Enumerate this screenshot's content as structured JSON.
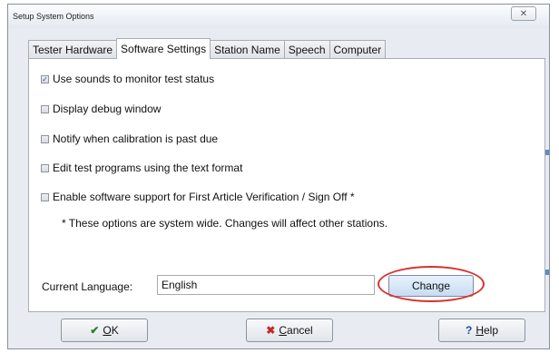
{
  "window": {
    "title": "Setup System Options",
    "close_glyph": "✕"
  },
  "tabs": [
    {
      "label": "Tester Hardware",
      "active": false
    },
    {
      "label": "Software Settings",
      "active": true
    },
    {
      "label": "Station Name",
      "active": false
    },
    {
      "label": "Speech",
      "active": false
    },
    {
      "label": "Computer",
      "active": false
    }
  ],
  "options": [
    {
      "label": "Use sounds to monitor test status",
      "checked": true
    },
    {
      "label": "Display debug window",
      "checked": false
    },
    {
      "label": "Notify when calibration is past due",
      "checked": false
    },
    {
      "label": "Edit test programs using the text format",
      "checked": false
    },
    {
      "label": "Enable software support for First Article Verification / Sign Off *",
      "checked": false
    }
  ],
  "note": "* These options are system wide. Changes will affect other stations.",
  "language": {
    "label": "Current Language:",
    "value": "English",
    "change_label": "Change"
  },
  "buttons": {
    "ok": {
      "icon": "check-icon",
      "glyph": "✔",
      "accel": "O",
      "rest": "K",
      "color": "#2e7d32"
    },
    "cancel": {
      "icon": "x-icon",
      "glyph": "✖",
      "accel": "C",
      "rest": "ancel",
      "color": "#c62828"
    },
    "help": {
      "icon": "question-icon",
      "glyph": "?",
      "accel": "H",
      "rest": "elp",
      "color": "#1f4fa3"
    }
  },
  "colors": {
    "highlight_ring": "#d9312f",
    "check": "#2a4f9a"
  }
}
